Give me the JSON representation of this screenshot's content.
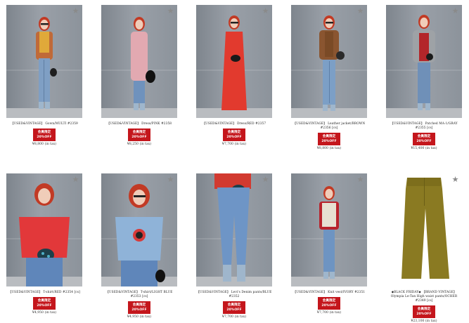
{
  "products": [
    {
      "title": "【USED&VINTAGE】 Gown/MULTI #2359",
      "badge_line1": "会員限定",
      "badge_line2": "20%OFF",
      "price": "¥8,800 (in tax)",
      "top_color": "#e0a93a",
      "bottom_color": "#7f9fc4",
      "outer_color": "#c06a38"
    },
    {
      "title": "【USED&VINTAGE】 Dress/PINK #2358",
      "badge_line1": "会員限定",
      "badge_line2": "20%OFF",
      "price": "¥8,250 (in tax)",
      "top_color": "#e2a9b1",
      "bottom_color": "#6f92bd",
      "outer_color": "#e2a9b1"
    },
    {
      "title": "【USED&VINTAGE】 Dress/RED #2357",
      "badge_line1": "会員限定",
      "badge_line2": "20%OFF",
      "price": "¥7,700 (in tax)",
      "top_color": "#e23a2e",
      "bottom_color": "#e23a2e",
      "outer_color": "#e23a2e"
    },
    {
      "title": "【USED&VINTAGE】 Leather jacket/BROWN #2356 [cs]",
      "badge_line1": "会員限定",
      "badge_line2": "20%OFF",
      "price": "¥8,800 (in tax)",
      "top_color": "#7a4a26",
      "bottom_color": "#7c9fc6",
      "outer_color": "#8a5530"
    },
    {
      "title": "【USED&VINTAGE】 Patched MA-1/GRAY #2355 [cs]",
      "badge_line1": "会員限定",
      "badge_line2": "20%OFF",
      "price": "¥15,400 (in tax)",
      "top_color": "#b3262a",
      "bottom_color": "#6f90b8",
      "outer_color": "#9ea2a6"
    },
    {
      "title": "【USED&VINTAGE】 T-shirt/RED #2354 [cs]",
      "badge_line1": "会員限定",
      "badge_line2": "20%OFF",
      "price": "¥4,950 (in tax)",
      "top_color": "#e2383a",
      "bottom_color": "#5f86ba",
      "outer_color": "#e2383a"
    },
    {
      "title": "【USED&VINTAGE】 T-shirt/LIGHT BLUE #2353 [cs]",
      "badge_line1": "会員限定",
      "badge_line2": "20%OFF",
      "price": "¥4,950 (in tax)",
      "top_color": "#8fb3d8",
      "bottom_color": "#5f86ba",
      "outer_color": "#8fb3d8"
    },
    {
      "title": "【USED&VINTAGE】 Levi's Denim pants/BLUE #2352",
      "badge_line1": "会員限定",
      "badge_line2": "20%OFF",
      "price": "¥7,700 (in tax)",
      "top_color": "#d23a30",
      "bottom_color": "#6e95c6",
      "outer_color": "#d23a30"
    },
    {
      "title": "【USED&VINTAGE】 Knit vest/IVORY #2351",
      "badge_line1": "会員限定",
      "badge_line2": "20%OFF",
      "price": "¥7,700 (in tax)",
      "top_color": "#b8232c",
      "bottom_color": "#6e94c2",
      "outer_color": "#e7e0d2"
    },
    {
      "title": "◆BLACK FRIDAY◆ 【BRAND VINTAGE】 Olympia Le-Tan High waist pants/OCHER #2349 [cs]",
      "badge_line1": "会員限定",
      "badge_line2": "20%OFF",
      "price": "¥23,100 (in tax)",
      "top_color": "#8a7a22",
      "bottom_color": "#8a7a22",
      "outer_color": "#8a7a22"
    }
  ],
  "favorite_icon": "star-icon"
}
